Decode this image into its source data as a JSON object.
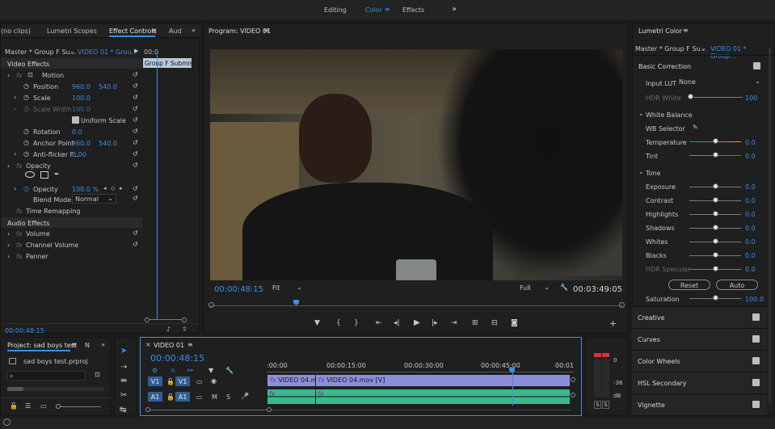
{
  "workspaces": {
    "editing": "Editing",
    "color": "Color",
    "effects": "Effects",
    "more": "»"
  },
  "source_panel": {
    "tabs": [
      "(no clips)",
      "Lumetri Scopes",
      "Effect Controls",
      "Aud"
    ],
    "master": "Master * Group F Su...",
    "clip": "VIDEO 01 * Grou...",
    "tooltip": "Group F Submissi",
    "timecode_top": "00:0",
    "video_effects": "Video Effects",
    "motion": "Motion",
    "rows": [
      {
        "label": "Position",
        "v1": "960.0",
        "v2": "540.0"
      },
      {
        "label": "Scale",
        "v1": "100.0",
        "v2": ""
      },
      {
        "label": "Scale Width",
        "v1": "100.0",
        "v2": ""
      },
      {
        "label": "Uniform Scale",
        "v1": "",
        "v2": ""
      },
      {
        "label": "Rotation",
        "v1": "0.0",
        "v2": ""
      },
      {
        "label": "Anchor Point",
        "v1": "960.0",
        "v2": "540.0"
      },
      {
        "label": "Anti-flicker F...",
        "v1": "0.00",
        "v2": ""
      }
    ],
    "opacity": "Opacity",
    "opacity_val": "100.0 %",
    "blend_mode_label": "Blend Mode",
    "blend_mode": "Normal",
    "time_remap": "Time Remapping",
    "audio_effects": "Audio Effects",
    "volume": "Volume",
    "channel_volume": "Channel Volume",
    "panner": "Panner",
    "timecode_bottom": "00:00:48:15"
  },
  "program": {
    "title": "Program: VIDEO 01",
    "timecode": "00:00:48:15",
    "fit": "Fit",
    "quality": "Full",
    "duration": "00:03:49:05"
  },
  "project": {
    "tab": "Project: sad boys test",
    "tab2": "N",
    "file": "sad boys test.prproj"
  },
  "timeline": {
    "title": "VIDEO 01",
    "timecode": "00:00:48:15",
    "ruler": [
      ":00:00",
      "00:00:15:00",
      "00:00:30:00",
      "00:00:45:00",
      "00:01"
    ],
    "v1": "V1",
    "a1": "A1",
    "clip1": "VIDEO 04.mov",
    "clip2": "VIDEO 04.mov [V]",
    "m": "M",
    "s": "S",
    "meter_labels": [
      "0",
      "-36",
      "dB"
    ]
  },
  "lumetri": {
    "title": "Lumetri Color",
    "master": "Master * Group F Su...",
    "clip": "VIDEO 01 * Group...",
    "basic": "Basic Correction",
    "input_lut_label": "Input LUT",
    "input_lut": "None",
    "hdr_white": "HDR White",
    "hdr_white_val": "100",
    "white_balance": "White Balance",
    "wb_selector": "WB Selector",
    "temperature": "Temperature",
    "temperature_val": "0.0",
    "tint": "Tint",
    "tint_val": "0.0",
    "tone": "Tone",
    "tone_rows": [
      {
        "label": "Exposure",
        "val": "0.0"
      },
      {
        "label": "Contrast",
        "val": "0.0"
      },
      {
        "label": "Highlights",
        "val": "0.0"
      },
      {
        "label": "Shadows",
        "val": "0.0"
      },
      {
        "label": "Whites",
        "val": "0.0"
      },
      {
        "label": "Blacks",
        "val": "0.0"
      },
      {
        "label": "HDR Specular",
        "val": "0.0"
      }
    ],
    "reset": "Reset",
    "auto": "Auto",
    "saturation": "Saturation",
    "saturation_val": "100.0",
    "sections": [
      "Creative",
      "Curves",
      "Color Wheels",
      "HSL Secondary",
      "Vignette"
    ]
  },
  "colors": {
    "accent": "#3a8fe8",
    "video_clip": "#8c8fd8",
    "audio_clip": "#3cb88c"
  }
}
